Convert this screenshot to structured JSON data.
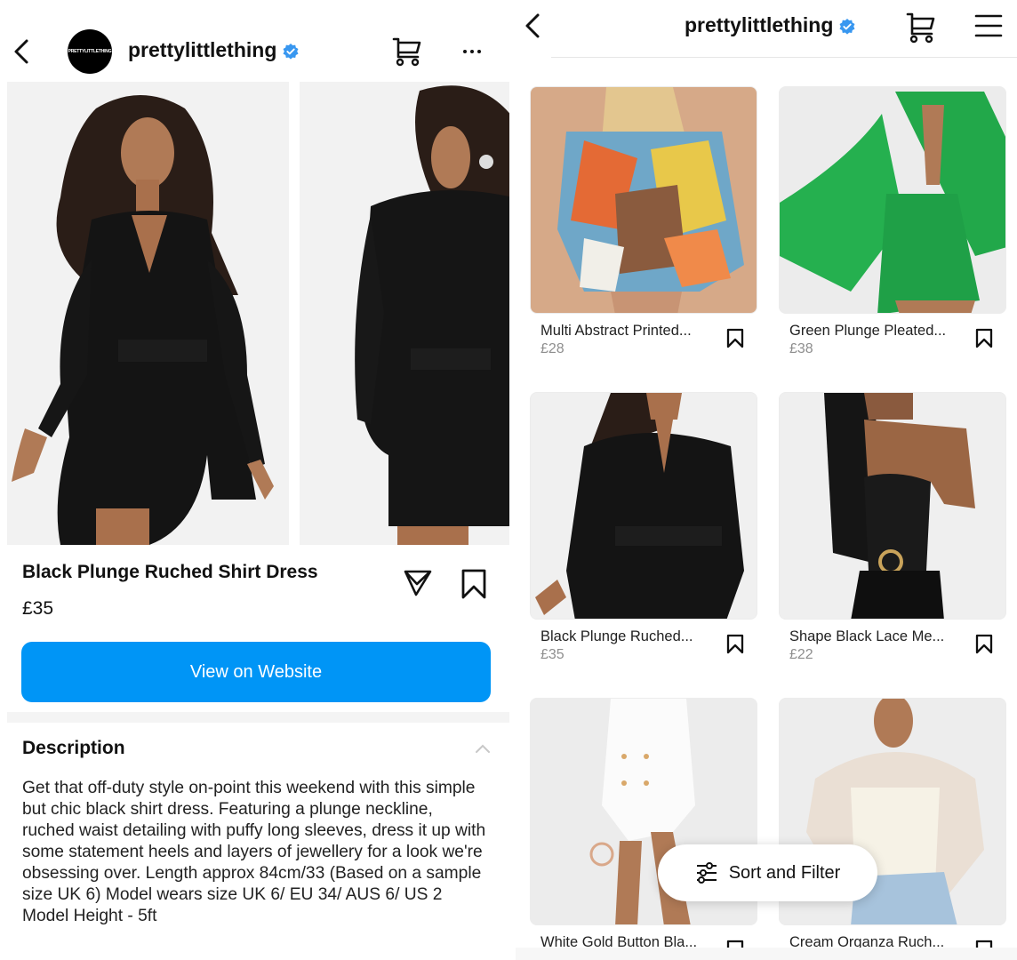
{
  "left_panel": {
    "header": {
      "avatar_text": "PRETTYLITTLETHING",
      "username": "prettylittlething",
      "verified": true,
      "icons": [
        "back-icon",
        "cart-icon",
        "more-icon"
      ]
    },
    "product": {
      "name": "Black Plunge Ruched Shirt Dress",
      "price": "£35",
      "images": [
        "front view of model in black plunge shirt dress",
        "back view of model in black plunge shirt dress"
      ],
      "view_button_label": "View on Website"
    },
    "description": {
      "title": "Description",
      "body": "Get that off-duty style on-point this weekend with this simple but chic black shirt dress. Featuring a plunge neckline, ruched waist detailing with puffy long sleeves, dress it up with some statement heels and layers of jewellery for a look we're obsessing over. Length approx 84cm/33 (Based on a sample size UK 6) Model wears size UK 6/ EU 34/ AUS 6/ US 2 Model Height - 5ft"
    }
  },
  "right_panel": {
    "header": {
      "username": "prettylittlething",
      "verified": true,
      "icons": [
        "back-icon",
        "cart-icon",
        "menu-icon"
      ]
    },
    "products": [
      {
        "name": "Multi Abstract Printed...",
        "price": "£28",
        "image": "multicolor abstract print shirt"
      },
      {
        "name": "Green Plunge Pleated...",
        "price": "£38",
        "image": "green pleated dress with bell sleeves"
      },
      {
        "name": "Black Plunge Ruched...",
        "price": "£35",
        "image": "black plunge ruched shirt dress"
      },
      {
        "name": "Shape Black Lace Me...",
        "price": "£22",
        "image": "black lace mesh bodysuit"
      },
      {
        "name": "White Gold Button Bla...",
        "price": "",
        "image": "white gold button blazer dress"
      },
      {
        "name": "Cream Organza Ruch...",
        "price": "",
        "image": "cream organza ruched top"
      }
    ],
    "sort_filter_label": "Sort and Filter"
  },
  "colors": {
    "primary_button": "#0095f6",
    "verified_badge": "#3897f0",
    "secondary_text": "#8e8e8e"
  }
}
